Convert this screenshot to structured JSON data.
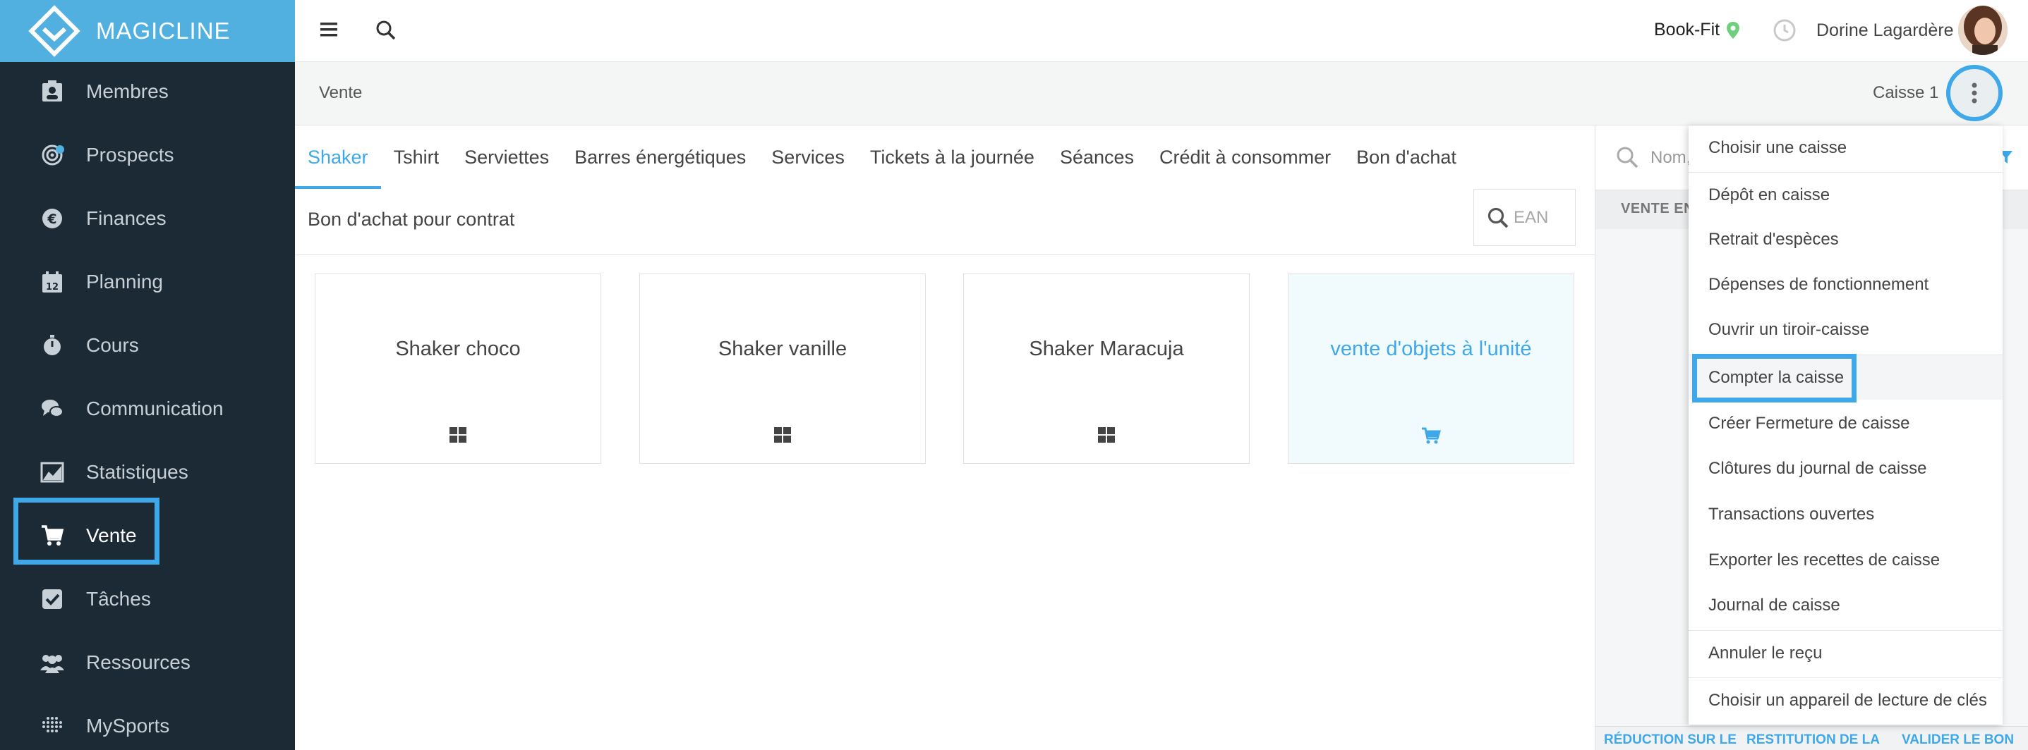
{
  "app": {
    "name": "MAGICLINE"
  },
  "sidebar": {
    "items": [
      {
        "label": "Membres",
        "icon": "member-card-icon"
      },
      {
        "label": "Prospects",
        "icon": "target-icon"
      },
      {
        "label": "Finances",
        "icon": "euro-coin-icon"
      },
      {
        "label": "Planning",
        "icon": "calendar-icon"
      },
      {
        "label": "Cours",
        "icon": "stopwatch-icon"
      },
      {
        "label": "Communication",
        "icon": "chat-bubbles-icon"
      },
      {
        "label": "Statistiques",
        "icon": "area-chart-icon"
      },
      {
        "label": "Vente",
        "icon": "cart-icon",
        "active": true
      },
      {
        "label": "Tâches",
        "icon": "checkbox-icon"
      },
      {
        "label": "Ressources",
        "icon": "people-icon"
      },
      {
        "label": "MySports",
        "icon": "dots-grid-icon"
      }
    ]
  },
  "topbar": {
    "studio": "Book-Fit",
    "user": "Dorine Lagardère"
  },
  "header": {
    "breadcrumb": "Vente",
    "register": "Caisse 1"
  },
  "tabs": {
    "row1": [
      "Shaker",
      "Tshirt",
      "Serviettes",
      "Barres énergétiques",
      "Services",
      "Tickets à la journée",
      "Séances",
      "Crédit à consommer",
      "Bon d'achat"
    ],
    "row2": "Bon d'achat pour contrat",
    "ean_placeholder": "EAN"
  },
  "products": [
    {
      "name": "Shaker choco",
      "icon": "grid-icon"
    },
    {
      "name": "Shaker vanille",
      "icon": "grid-icon"
    },
    {
      "name": "Shaker Maracuja",
      "icon": "grid-icon"
    },
    {
      "name": "vente d'objets à l'unité",
      "icon": "cart-icon"
    }
  ],
  "right_panel": {
    "search_placeholder": "Nom,",
    "header": "VENTE EN",
    "footer": [
      "RÉDUCTION SUR LE",
      "RESTITUTION DE LA",
      "VALIDER LE BON"
    ]
  },
  "menu": {
    "items": [
      "Choisir une caisse",
      "Dépôt en caisse",
      "Retrait d'espèces",
      "Dépenses de fonctionnement",
      "Ouvrir un tiroir-caisse",
      "Compter la caisse",
      "Créer Fermeture de caisse",
      "Clôtures du journal de caisse",
      "Transactions ouvertes",
      "Exporter les recettes de caisse",
      "Journal de caisse",
      "Annuler le reçu",
      "Choisir un appareil de lecture de clés"
    ]
  },
  "colors": {
    "accent": "#3fa8e8",
    "sidebar": "#1c2a35",
    "logo_bg": "#52b0e1"
  }
}
